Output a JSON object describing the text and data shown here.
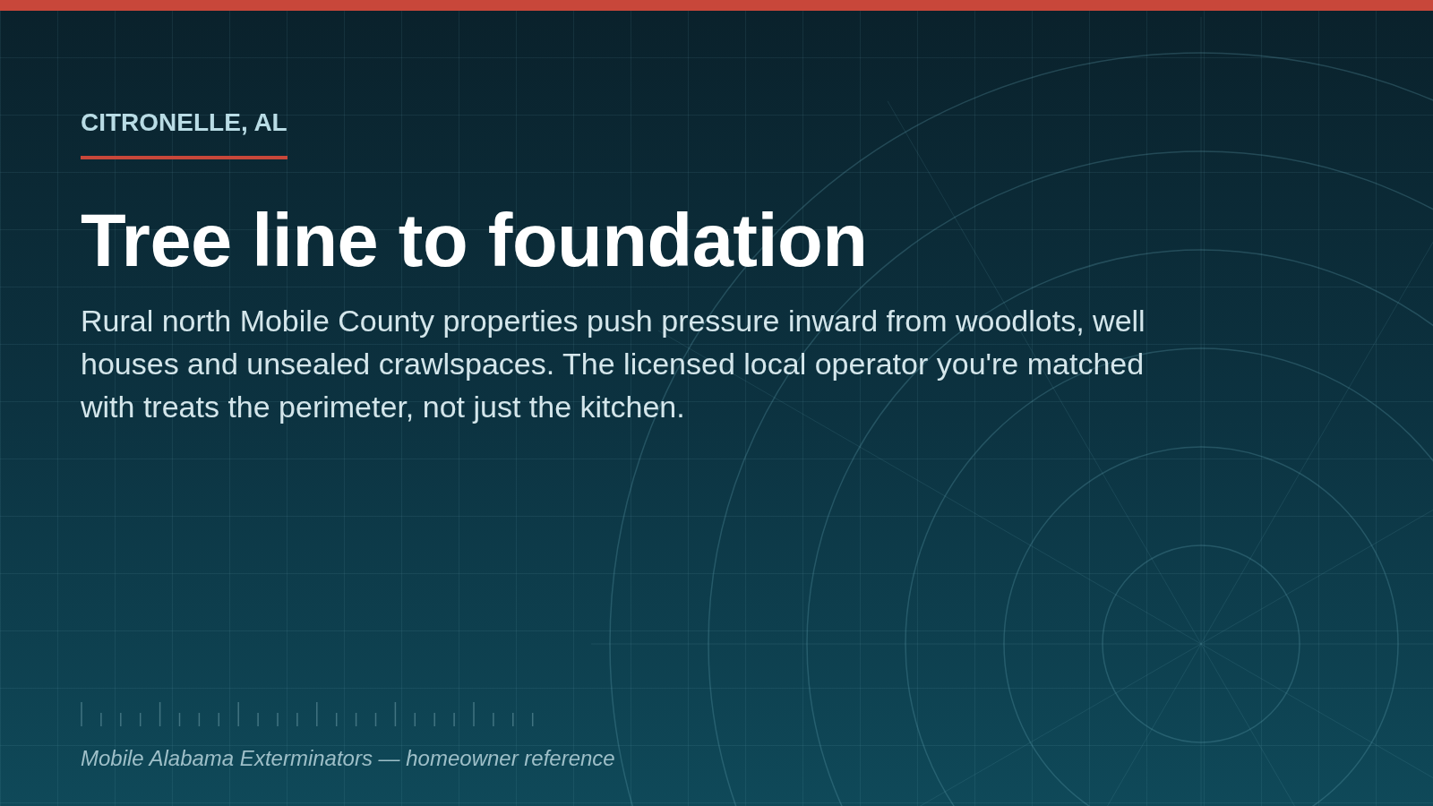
{
  "eyebrow": "CITRONELLE, AL",
  "headline": "Tree line to foundation",
  "body": "Rural north Mobile County properties push pressure inward from woodlots, well houses and unsealed crawlspaces. The licensed local operator you're matched with treats the perimeter, not just the kitchen.",
  "footer": "Mobile Alabama Exterminators — homeowner reference"
}
